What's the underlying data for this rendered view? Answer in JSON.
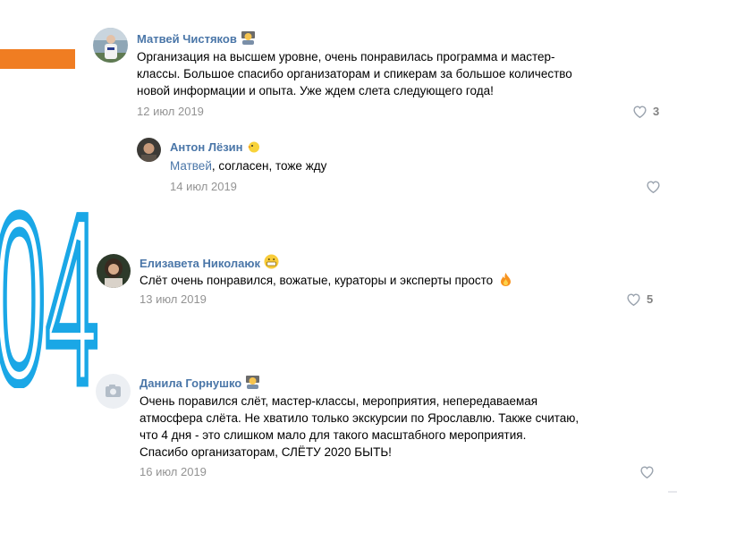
{
  "colors": {
    "accent_orange": "#f07d22",
    "accent_cyan": "#1aa7e6",
    "link_blue": "#4a76a8",
    "meta_gray": "#939393"
  },
  "slide_number": "04",
  "comments": [
    {
      "author": "Матвей Чистяков",
      "author_emoji": "teacher-emoji",
      "lines": [
        "Организация на высшем уровне, очень понравилась программа и мастер-",
        "классы. Большое спасибо организаторам и спикерам за большое количество",
        "новой информации и опыта. Уже ждем слета следующего года!"
      ],
      "date": "12 июл 2019",
      "likes": "3"
    },
    {
      "author": "Антон Лёзин",
      "author_emoji": "chick-emoji",
      "mention": "Матвей",
      "text": ", согласен, тоже жду",
      "date": "14 июл 2019",
      "likes": ""
    },
    {
      "author": "Елизавета Николаюк",
      "author_emoji": "grimace-emoji",
      "text": "Слёт очень понравился, вожатые, кураторы и эксперты просто",
      "text_emoji": "fire-emoji",
      "date": "13 июл 2019",
      "likes": "5"
    },
    {
      "author": "Данила Горнушко",
      "author_emoji": "teacher-emoji",
      "lines": [
        "Очень поравился слёт, мастер-классы, мероприятия, непередаваемая",
        "атмосфера слёта. Не хватило только экскурсии по Ярославлю. Также считаю,",
        "что 4 дня - это слишком мало для такого масштабного мероприятия.",
        "Спасибо организаторам, СЛЁТУ 2020 БЫТЬ!"
      ],
      "date": "16 июл 2019",
      "likes": ""
    }
  ]
}
